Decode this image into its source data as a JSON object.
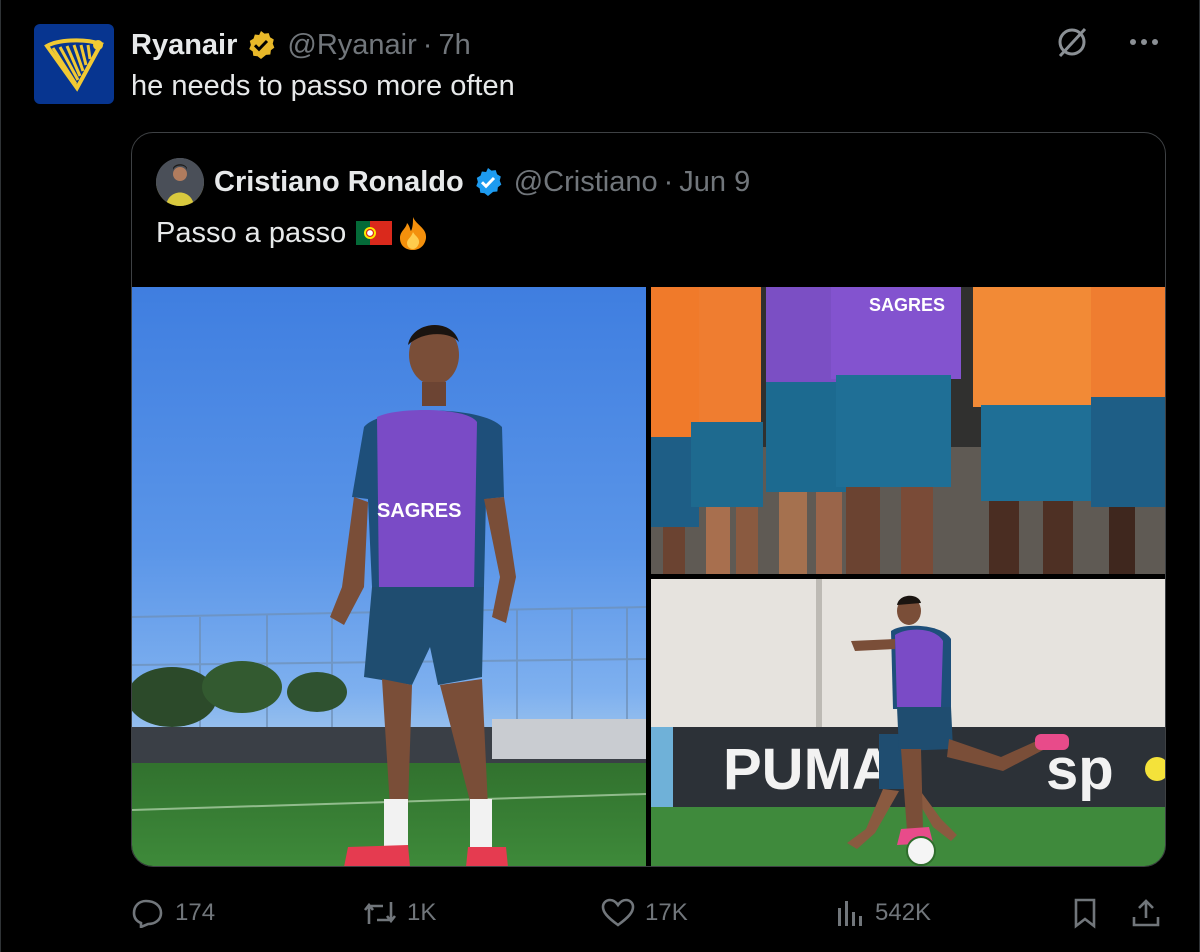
{
  "tweet": {
    "author_name": "Ryanair",
    "author_handle": "@Ryanair",
    "separator": "·",
    "time": "7h",
    "text": "he needs to passo more often"
  },
  "quote": {
    "author_name": "Cristiano Ronaldo",
    "author_handle": "@Cristiano",
    "separator": "·",
    "date": "Jun 9",
    "text": "Passo a passo",
    "emoji_flag": "🇵🇹",
    "emoji_fire": "🔥",
    "photos": [
      {
        "text_on_image": "SAGRES"
      },
      {
        "text_on_image": "SAGRES"
      },
      {
        "text_on_image": "PUMA"
      }
    ]
  },
  "actions": {
    "replies": "174",
    "reposts": "1K",
    "likes": "17K",
    "views": "542K"
  },
  "colors": {
    "background": "#000000",
    "text": "#e7e9ea",
    "muted": "#71767b",
    "gold_badge": "#e8b829",
    "blue_badge": "#1d9bf0",
    "ryanair_blue": "#073590",
    "ryanair_yellow": "#f1c933"
  },
  "icons": [
    "grok-icon",
    "more-icon",
    "reply-icon",
    "repost-icon",
    "like-icon",
    "views-icon",
    "bookmark-icon",
    "share-icon",
    "verified-gold-icon",
    "verified-blue-icon"
  ]
}
